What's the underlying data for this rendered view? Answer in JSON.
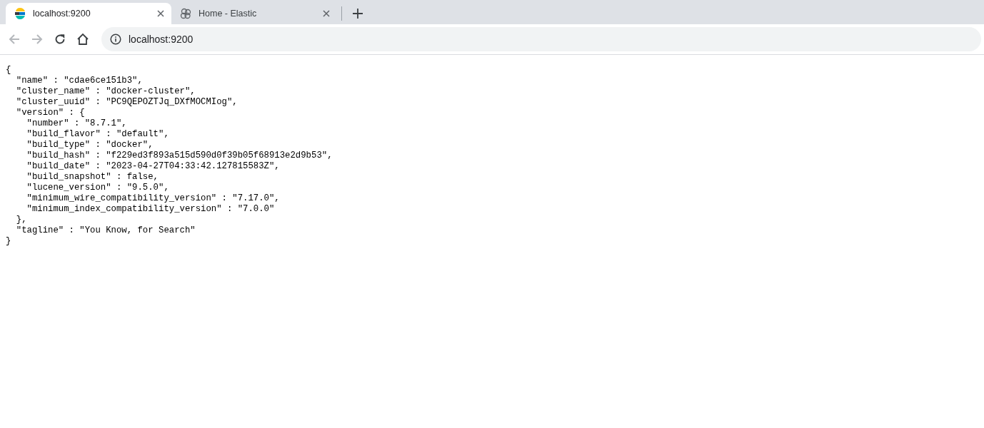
{
  "tabs": [
    {
      "title": "localhost:9200",
      "kind": "elastic",
      "selected": true
    },
    {
      "title": "Home - Elastic",
      "kind": "kibana",
      "selected": false
    }
  ],
  "toolbar": {
    "back_disabled": true,
    "forward_disabled": true
  },
  "address_bar": {
    "value": "localhost:9200"
  },
  "document": {
    "lines": [
      "{",
      "  \"name\" : \"cdae6ce151b3\",",
      "  \"cluster_name\" : \"docker-cluster\",",
      "  \"cluster_uuid\" : \"PC9QEPOZTJq_DXfMOCMIog\",",
      "  \"version\" : {",
      "    \"number\" : \"8.7.1\",",
      "    \"build_flavor\" : \"default\",",
      "    \"build_type\" : \"docker\",",
      "    \"build_hash\" : \"f229ed3f893a515d590d0f39b05f68913e2d9b53\",",
      "    \"build_date\" : \"2023-04-27T04:33:42.127815583Z\",",
      "    \"build_snapshot\" : false,",
      "    \"lucene_version\" : \"9.5.0\",",
      "    \"minimum_wire_compatibility_version\" : \"7.17.0\",",
      "    \"minimum_index_compatibility_version\" : \"7.0.0\"",
      "  },",
      "  \"tagline\" : \"You Know, for Search\"",
      "}"
    ]
  }
}
